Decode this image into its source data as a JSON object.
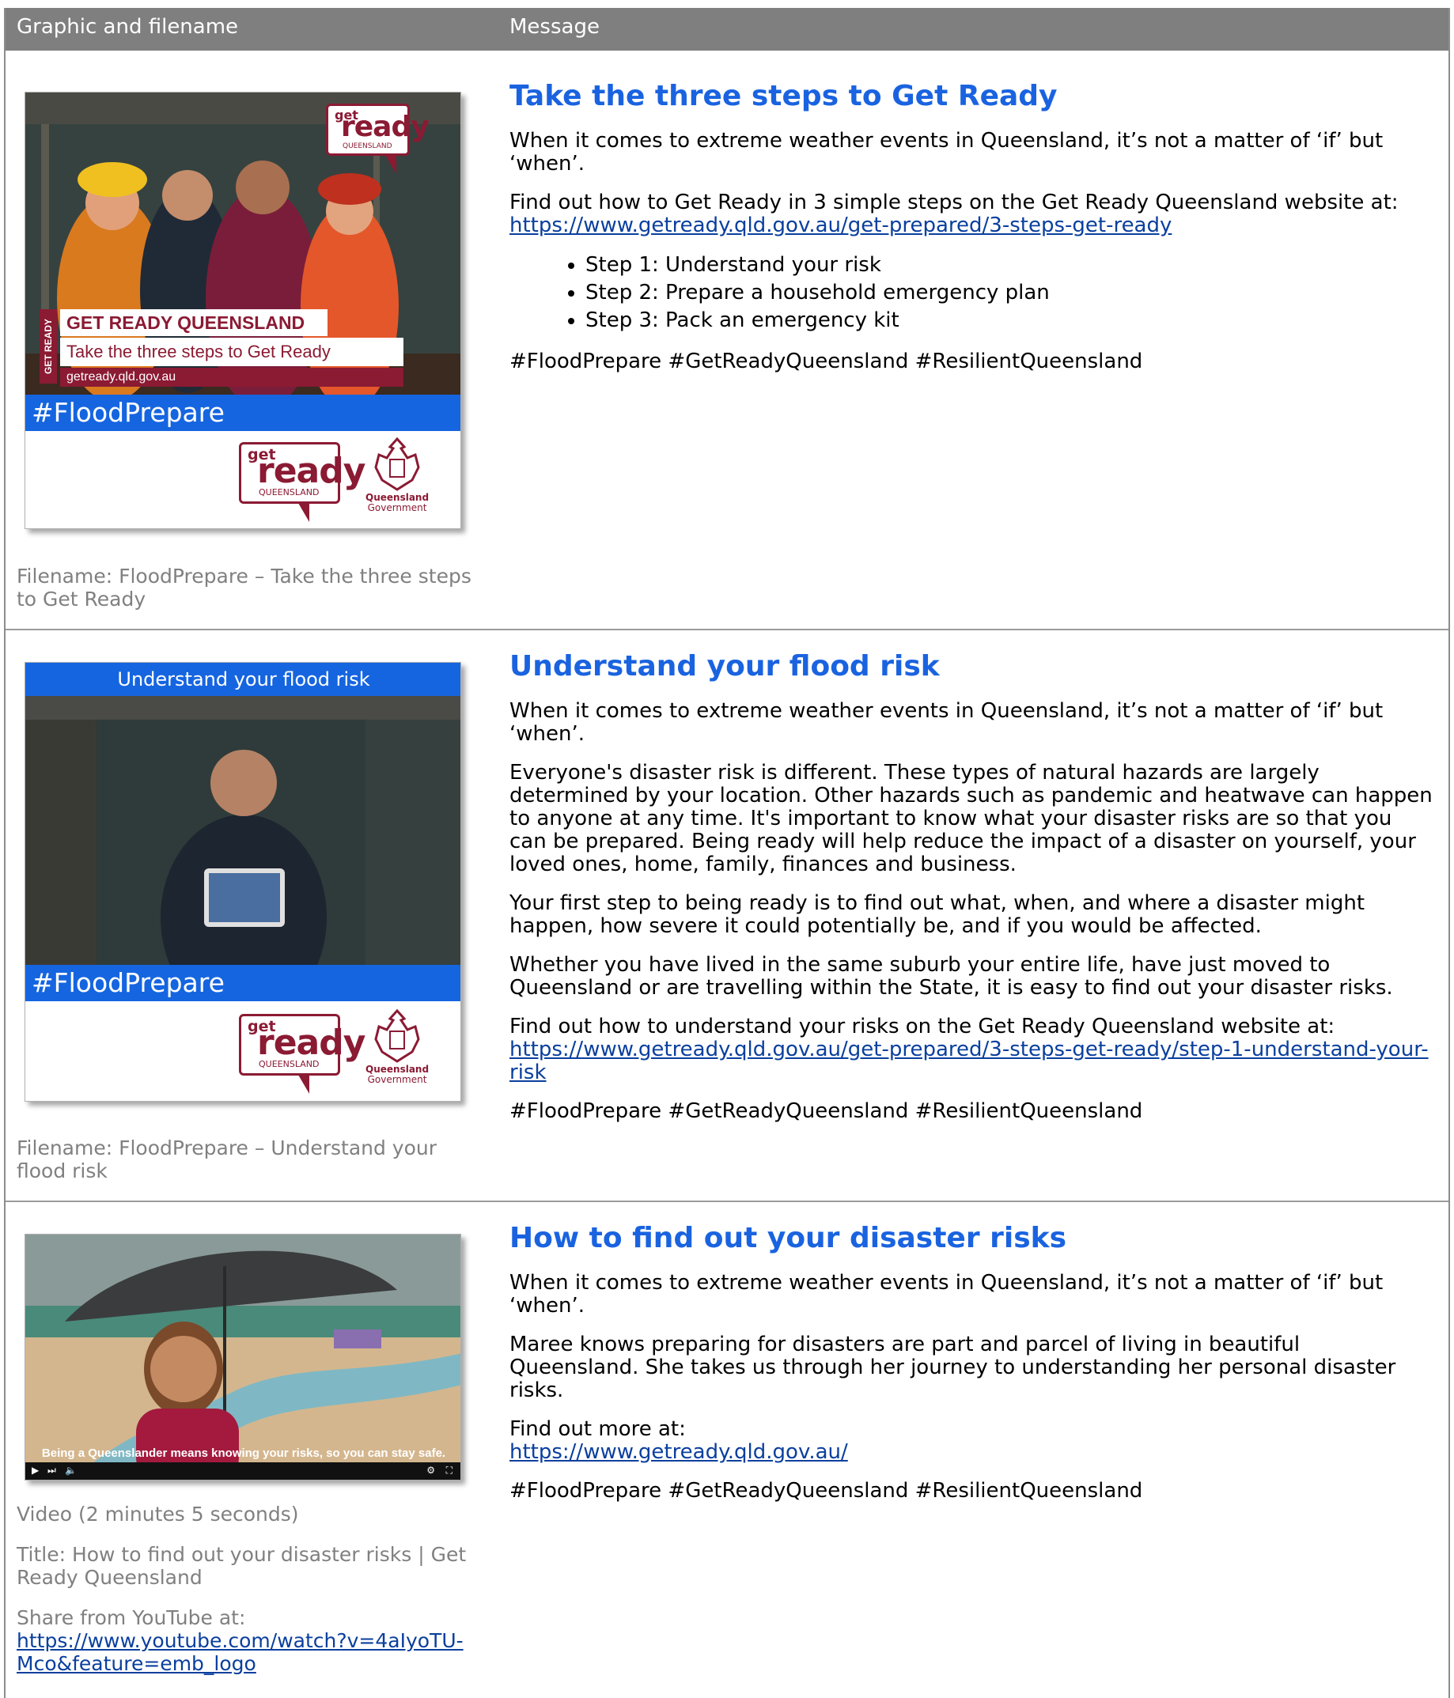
{
  "header": {
    "col1": "Graphic and filename",
    "col2": "Message"
  },
  "rows": [
    {
      "graphic": {
        "badge": {
          "get": "get",
          "ready": "ready",
          "queensland": "QUEENSLAND"
        },
        "overlay_vertical": "GET READY",
        "overlay_title": "GET READY QUEENSLAND",
        "overlay_sub": "Take the three steps to Get Ready",
        "overlay_url": "getready.qld.gov.au",
        "hashtag": "#FloodPrepare",
        "gov_label1": "Queensland",
        "gov_label2": "Government"
      },
      "filename": "Filename: FloodPrepare – Take the three steps to Get Ready",
      "heading": "Take the three steps to Get Ready",
      "p1": "When it comes to extreme weather events in Queensland, it’s not a matter of ‘if’ but ‘when’.",
      "p2": "Find out how to Get Ready in 3 simple steps on the Get Ready Queensland website at:",
      "link": "https://www.getready.qld.gov.au/get-prepared/3-steps-get-ready",
      "steps": [
        "Step 1: Understand your risk",
        "Step 2: Prepare a household emergency plan",
        "Step 3: Pack an emergency kit"
      ],
      "tags": "#FloodPrepare #GetReadyQueensland #ResilientQueensland"
    },
    {
      "graphic": {
        "top_banner": "Understand your flood risk",
        "hashtag": "#FloodPrepare",
        "gov_label1": "Queensland",
        "gov_label2": "Government"
      },
      "filename": "Filename: FloodPrepare – Understand your flood risk",
      "heading": "Understand your flood risk",
      "p1": "When it comes to extreme weather events in Queensland, it’s not a matter of ‘if’ but ‘when’.",
      "p2": "Everyone's disaster risk is different. These types of natural hazards are largely determined by your location. Other hazards such as pandemic and heatwave can happen to anyone at any time. It's important to know what your disaster risks are so that you can be prepared. Being ready will help reduce the impact of a disaster on yourself, your loved ones, home, family, finances and business.",
      "p3": "Your first step to being ready is to find out what, when, and where a disaster might happen, how severe it could potentially be, and if you would be affected.",
      "p4": "Whether you have lived in the same suburb your entire life, have just moved to Queensland or are travelling within the State, it is easy to find out your disaster risks.",
      "p5": "Find out how to understand your risks on the Get Ready Queensland website at:",
      "link": "https://www.getready.qld.gov.au/get-prepared/3-steps-get-ready/step-1-understand-your-risk",
      "tags": "#FloodPrepare #GetReadyQueensland #ResilientQueensland"
    },
    {
      "graphic": {
        "caption": "Being a Queenslander means knowing your risks, so you can stay safe."
      },
      "video_length": "Video (2 minutes 5 seconds)",
      "video_title": "Title: How to find out your disaster risks | Get Ready Queensland",
      "share_label": "Share from YouTube at:",
      "share_link": "https://www.youtube.com/watch?v=4aIyoTU-Mco&feature=emb_logo",
      "heading": "How to find out your disaster risks",
      "p1": "When it comes to extreme weather events in Queensland, it’s not a matter of ‘if’ but ‘when’.",
      "p2": "Maree knows preparing for disasters are part and parcel of living in beautiful Queensland. She takes us through her journey to understanding her personal disaster risks.",
      "p3": "Find out more at:",
      "link": "https://www.getready.qld.gov.au/",
      "tags": "#FloodPrepare #GetReadyQueensland #ResilientQueensland"
    }
  ],
  "colors": {
    "header_bg": "#7f7f7f",
    "heading": "#1a63e0",
    "link": "#0a3f9e",
    "brand_maroon": "#8b1a33",
    "hashtag_bar": "#1565e0"
  }
}
